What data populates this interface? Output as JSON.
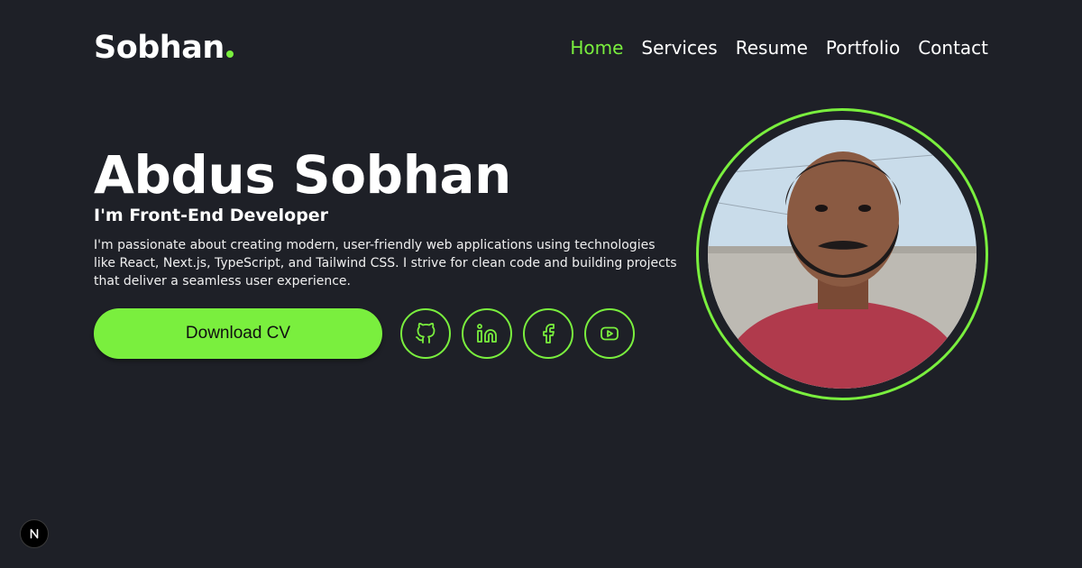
{
  "header": {
    "logo_text": "Sobhan",
    "nav": [
      {
        "label": "Home",
        "active": true
      },
      {
        "label": "Services",
        "active": false
      },
      {
        "label": "Resume",
        "active": false
      },
      {
        "label": "Portfolio",
        "active": false
      },
      {
        "label": "Contact",
        "active": false
      }
    ]
  },
  "hero": {
    "name": "Abdus Sobhan",
    "role": "I'm Front-End Developer",
    "description_lines": [
      "I'm passionate about creating modern, user-friendly web applications using technologies",
      "like React, Next.js, TypeScript, and Tailwind CSS. I strive for clean code and building projects",
      "that deliver a seamless user experience."
    ],
    "cta_label": "Download CV"
  },
  "socials": [
    {
      "icon": "github-icon"
    },
    {
      "icon": "linkedin-icon"
    },
    {
      "icon": "facebook-icon"
    },
    {
      "icon": "youtube-icon"
    }
  ],
  "portrait": {
    "icon": "profile-photo"
  },
  "dev_badge": {
    "icon": "nextjs-icon"
  },
  "colors": {
    "background": "#1e2027",
    "accent": "#7aef3e",
    "text": "#ffffff"
  }
}
